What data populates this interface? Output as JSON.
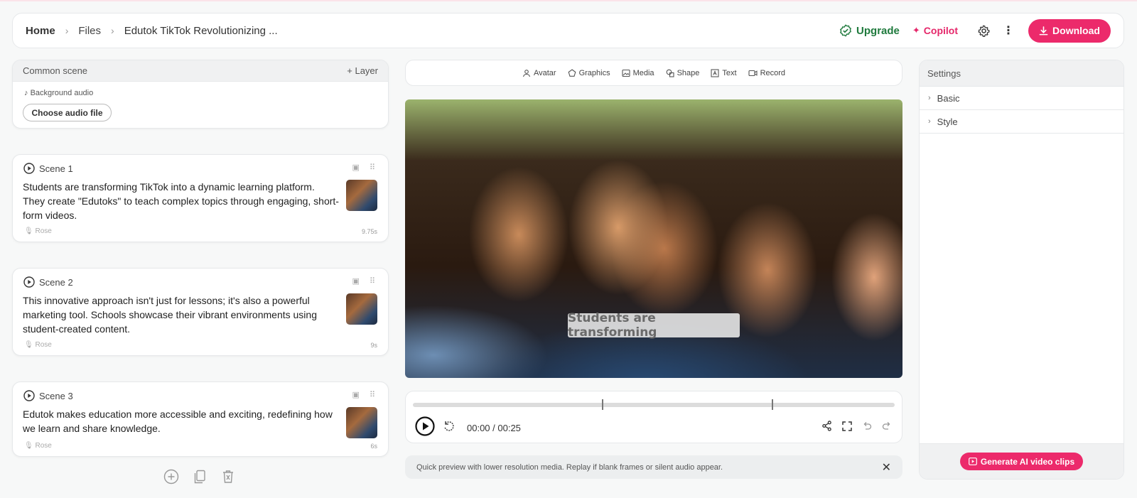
{
  "header": {
    "breadcrumb": {
      "home": "Home",
      "files": "Files",
      "current": "Edutok TikTok Revolutionizing ..."
    },
    "upgrade_label": "Upgrade",
    "copilot_label": "Copilot",
    "download_label": "Download"
  },
  "common_scene": {
    "title": "Common scene",
    "layer_label": "+ Layer",
    "background_audio_label": "Background audio",
    "choose_audio_label": "Choose audio file"
  },
  "scenes": [
    {
      "title": "Scene 1",
      "text": "Students are transforming TikTok into a dynamic learning platform. They create \"Edutoks\" to teach complex topics through engaging, short-form videos.",
      "voice": "Rose",
      "duration": "9.75s"
    },
    {
      "title": "Scene 2",
      "text": "This innovative approach isn't just for lessons; it's also a powerful marketing tool. Schools showcase their vibrant environments using student-created content.",
      "voice": "Rose",
      "duration": "9s"
    },
    {
      "title": "Scene 3",
      "text": "Edutok makes education more accessible and exciting, redefining how we learn and share knowledge.",
      "voice": "Rose",
      "duration": "6s"
    }
  ],
  "toolbar": {
    "avatar": "Avatar",
    "graphics": "Graphics",
    "media": "Media",
    "shape": "Shape",
    "text": "Text",
    "record": "Record"
  },
  "preview": {
    "caption": "Students are transforming"
  },
  "player": {
    "time": "00:00 / 00:25"
  },
  "notice": {
    "text": "Quick preview with lower resolution media. Replay if blank frames or silent audio appear.",
    "close": "✕"
  },
  "settings": {
    "title": "Settings",
    "sections": [
      "Basic",
      "Style"
    ],
    "generate_label": "Generate AI video clips"
  },
  "colors": {
    "accent": "#ec2a6b",
    "upgrade_green": "#1f7a3d"
  }
}
